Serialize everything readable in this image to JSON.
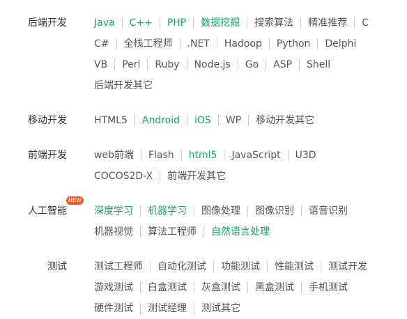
{
  "categories": [
    {
      "label": "后端开发",
      "rows": [
        [
          {
            "text": "Java",
            "hl": true
          },
          {
            "text": "C++",
            "hl": true
          },
          {
            "text": "PHP",
            "hl": true
          },
          {
            "text": "数据挖掘",
            "hl": true
          },
          {
            "text": "搜索算法"
          },
          {
            "text": "精准推荐"
          },
          {
            "text": "C"
          }
        ],
        [
          {
            "text": "C#"
          },
          {
            "text": "全栈工程师"
          },
          {
            "text": ".NET"
          },
          {
            "text": "Hadoop"
          },
          {
            "text": "Python"
          },
          {
            "text": "Delphi"
          }
        ],
        [
          {
            "text": "VB"
          },
          {
            "text": "Perl"
          },
          {
            "text": "Ruby"
          },
          {
            "text": "Node.js"
          },
          {
            "text": "Go"
          },
          {
            "text": "ASP"
          },
          {
            "text": "Shell"
          }
        ],
        [
          {
            "text": "后端开发其它"
          }
        ]
      ]
    },
    {
      "label": "移动开发",
      "rows": [
        [
          {
            "text": "HTML5"
          },
          {
            "text": "Android",
            "hl": true
          },
          {
            "text": "iOS",
            "hl": true
          },
          {
            "text": "WP"
          },
          {
            "text": "移动开发其它"
          }
        ]
      ]
    },
    {
      "label": "前端开发",
      "rows": [
        [
          {
            "text": "web前端"
          },
          {
            "text": "Flash"
          },
          {
            "text": "html5",
            "hl": true
          },
          {
            "text": "JavaScript"
          },
          {
            "text": "U3D"
          }
        ],
        [
          {
            "text": "COCOS2D-X"
          },
          {
            "text": "前端开发其它"
          }
        ]
      ]
    },
    {
      "label": "人工智能",
      "badge": "NEW",
      "rows": [
        [
          {
            "text": "深度学习",
            "hl": true
          },
          {
            "text": "机器学习",
            "hl": true
          },
          {
            "text": "图像处理"
          },
          {
            "text": "图像识别"
          },
          {
            "text": "语音识别"
          }
        ],
        [
          {
            "text": "机器视觉"
          },
          {
            "text": "算法工程师"
          },
          {
            "text": "自然语言处理",
            "hl": true
          }
        ]
      ]
    },
    {
      "label": "测试",
      "rows": [
        [
          {
            "text": "测试工程师"
          },
          {
            "text": "自动化测试"
          },
          {
            "text": "功能测试"
          },
          {
            "text": "性能测试"
          },
          {
            "text": "测试开发"
          }
        ],
        [
          {
            "text": "游戏测试"
          },
          {
            "text": "白盒测试"
          },
          {
            "text": "灰盒测试"
          },
          {
            "text": "黑盒测试"
          },
          {
            "text": "手机测试"
          }
        ],
        [
          {
            "text": "硬件测试"
          },
          {
            "text": "测试经理"
          },
          {
            "text": "测试其它"
          }
        ]
      ]
    }
  ],
  "colors": {
    "highlight": "#18a077",
    "text": "#555555",
    "label": "#333333",
    "badge": "#f4592a"
  }
}
